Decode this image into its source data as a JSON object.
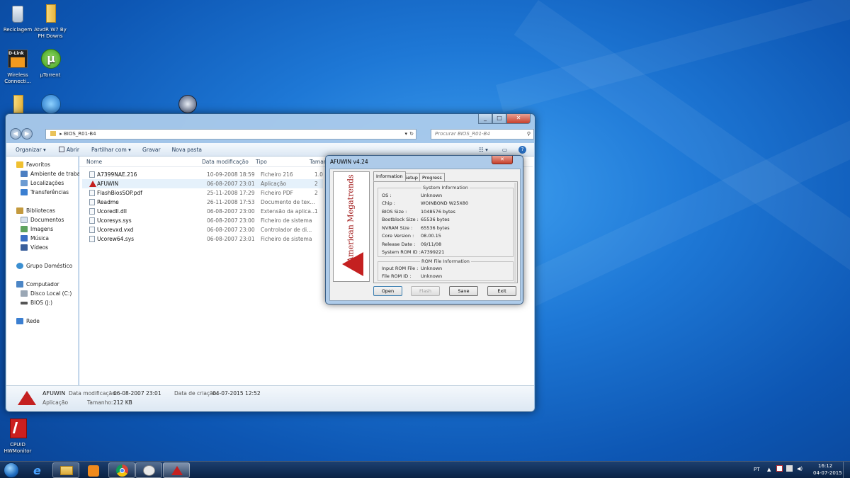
{
  "desktop": {
    "icons": [
      {
        "label": "Reciclagem"
      },
      {
        "label": "AtvdR W7 By PH Downs"
      },
      {
        "label": "Wireless Connecti..."
      },
      {
        "label": "µTorrent"
      },
      {
        "label": "CPUID HWMonitor"
      }
    ]
  },
  "explorer": {
    "address": "BIOS_R01-B4",
    "search_placeholder": "Procurar BIOS_R01-B4",
    "toolbar": {
      "organize": "Organizar ▾",
      "open": "Abrir",
      "share": "Partilhar com ▾",
      "burn": "Gravar",
      "new_folder": "Nova pasta"
    },
    "nav": {
      "favorites": "Favoritos",
      "desktop": "Ambiente de trabalh",
      "locations": "Localizações",
      "downloads": "Transferências",
      "libraries": "Bibliotecas",
      "documents": "Documentos",
      "images": "Imagens",
      "music": "Música",
      "videos": "Vídeos",
      "homegroup": "Grupo Doméstico",
      "computer": "Computador",
      "local_disk": "Disco Local (C:)",
      "bios_drive": "BIOS (J:)",
      "network": "Rede"
    },
    "columns": {
      "name": "Nome",
      "date": "Data modificação",
      "type": "Tipo",
      "size": "Taman"
    },
    "files": [
      {
        "name": "A7399NAE.216",
        "date": "10-09-2008 18:59",
        "type": "Ficheiro 216",
        "size": "1.0"
      },
      {
        "name": "AFUWIN",
        "date": "06-08-2007 23:01",
        "type": "Aplicação",
        "size": "2"
      },
      {
        "name": "FlashBiosSOP.pdf",
        "date": "25-11-2008 17:29",
        "type": "Ficheiro PDF",
        "size": "2"
      },
      {
        "name": "Readme",
        "date": "26-11-2008 17:53",
        "type": "Documento de tex...",
        "size": ""
      },
      {
        "name": "Ucoredll.dll",
        "date": "06-08-2007 23:00",
        "type": "Extensão da aplica...",
        "size": "1"
      },
      {
        "name": "Ucoresys.sys",
        "date": "06-08-2007 23:00",
        "type": "Ficheiro de sistema",
        "size": ""
      },
      {
        "name": "Ucorevxd.vxd",
        "date": "06-08-2007 23:00",
        "type": "Controlador de di...",
        "size": ""
      },
      {
        "name": "Ucorew64.sys",
        "date": "06-08-2007 23:01",
        "type": "Ficheiro de sistema",
        "size": ""
      }
    ],
    "details": {
      "name": "AFUWIN",
      "kind": "Aplicação",
      "modified_label": "Data modificação:",
      "modified": "06-08-2007 23:01",
      "created_label": "Data de criação:",
      "created": "04-07-2015 12:52",
      "size_label": "Tamanho:",
      "size": "212 KB"
    }
  },
  "afuwin": {
    "title": "AFUWIN v4.24",
    "logo_text": "American Megatrends",
    "tabs": [
      "Information",
      "Setup",
      "Progress"
    ],
    "system_info_title": "System Information",
    "system_info": [
      {
        "label": "OS :",
        "value": "Unknown"
      },
      {
        "label": "Chip :",
        "value": "WOINBOND W25X80"
      },
      {
        "label": "BIOS Size :",
        "value": "1048576 bytes"
      },
      {
        "label": "Bootblock Size :",
        "value": "65536 bytes"
      },
      {
        "label": "NVRAM Size :",
        "value": "65536 bytes"
      },
      {
        "label": "Core Version :",
        "value": "08.00.15"
      },
      {
        "label": "Release Date :",
        "value": "09/11/08"
      },
      {
        "label": "System ROM ID :",
        "value": "A7399221"
      }
    ],
    "rom_info_title": "ROM File Information",
    "rom_info": [
      {
        "label": "Input ROM File :",
        "value": "Unknown"
      },
      {
        "label": "File ROM ID :",
        "value": "Unknown"
      }
    ],
    "buttons": {
      "open": "Open",
      "flash": "Flash",
      "save": "Save",
      "exit": "Exit"
    }
  },
  "taskbar": {
    "language": "PT",
    "time": "16:12",
    "date": "04-07-2015"
  }
}
